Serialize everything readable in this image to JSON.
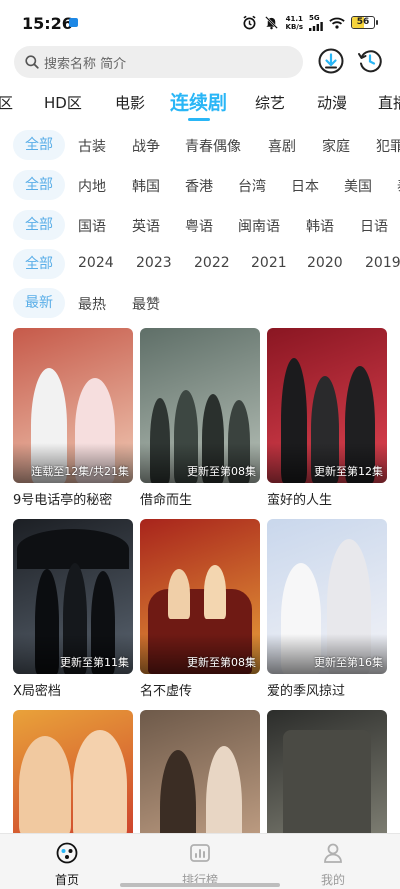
{
  "status_bar": {
    "time": "15:26",
    "net_speed_value": "41.1",
    "net_speed_unit": "KB/s",
    "signal_label": "5G",
    "battery_level": "56",
    "battery_fraction": 0.56,
    "icons": [
      "alarm-icon",
      "mute-icon",
      "signal-icon",
      "wifi-icon",
      "battery-icon"
    ]
  },
  "search": {
    "placeholder": "搜索名称 简介"
  },
  "category_tabs": {
    "items": [
      "区",
      "HD区",
      "电影",
      "连续剧",
      "综艺",
      "动漫",
      "直播"
    ],
    "active": "连续剧"
  },
  "filters": {
    "genre": [
      "全部",
      "古装",
      "战争",
      "青春偶像",
      "喜剧",
      "家庭",
      "犯罪"
    ],
    "region": [
      "全部",
      "内地",
      "韩国",
      "香港",
      "台湾",
      "日本",
      "美国",
      "泰国"
    ],
    "language": [
      "全部",
      "国语",
      "英语",
      "粤语",
      "闽南语",
      "韩语",
      "日语",
      "其他"
    ],
    "year": [
      "全部",
      "2024",
      "2023",
      "2022",
      "2021",
      "2020",
      "2019"
    ],
    "sort": [
      "最新",
      "最热",
      "最赞"
    ]
  },
  "grid": [
    {
      "title": "9号电话亭的秘密",
      "badge": "连载至12集/共21集",
      "colors": [
        "#c65a4a",
        "#f0c9b4"
      ]
    },
    {
      "title": "借命而生",
      "badge": "更新至第08集",
      "colors": [
        "#5f6f68",
        "#b7c1b8"
      ]
    },
    {
      "title": "蛮好的人生",
      "badge": "更新至第12集",
      "colors": [
        "#8a1622",
        "#e04452"
      ]
    },
    {
      "title": "X局密档",
      "badge": "更新至第11集",
      "colors": [
        "#1c1f24",
        "#5a6470"
      ]
    },
    {
      "title": "名不虚传",
      "badge": "更新至第08集",
      "colors": [
        "#a8241c",
        "#e9a03a"
      ]
    },
    {
      "title": "爱的季风掠过",
      "badge": "更新至第16集",
      "colors": [
        "#c9d7ec",
        "#f3f3f7"
      ]
    },
    {
      "title": "",
      "badge": "",
      "colors": [
        "#e9a23a",
        "#c9332a"
      ]
    },
    {
      "title": "",
      "badge": "",
      "colors": [
        "#6e5a4a",
        "#c9a68a"
      ]
    },
    {
      "title": "",
      "badge": "",
      "colors": [
        "#2c2d2b",
        "#8b8b7e"
      ]
    }
  ],
  "bottom_nav": {
    "items": [
      {
        "label": "首页",
        "icon": "home-icon",
        "active": true
      },
      {
        "label": "排行榜",
        "icon": "ranking-icon",
        "active": false
      },
      {
        "label": "我的",
        "icon": "profile-icon",
        "active": false
      }
    ]
  },
  "colors": {
    "accent": "#29b6f6",
    "selected_chip_bg": "#eef6fc",
    "selected_chip_text": "#5aaee8"
  }
}
